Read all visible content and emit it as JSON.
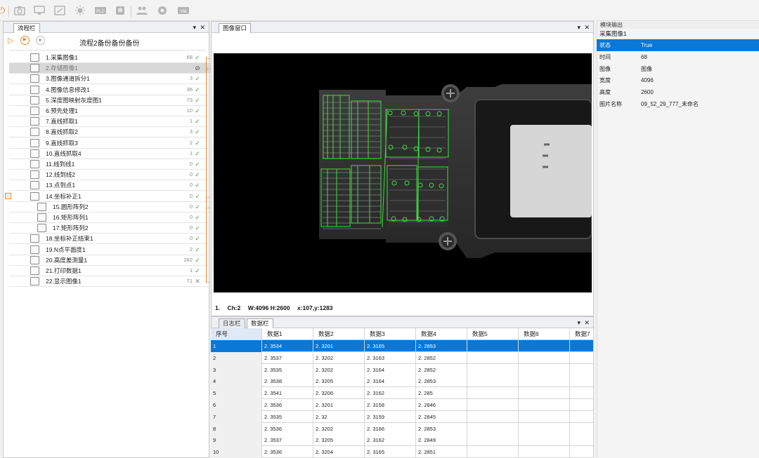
{
  "toolbar": {
    "icons": [
      "power-icon",
      "camera-icon",
      "screen-icon",
      "crop-icon",
      "light-icon",
      "plc-icon",
      "hand-icon",
      "users-icon",
      "settings-icon",
      "vm-icon"
    ],
    "plc_label": "PLC",
    "vm_label": "VM"
  },
  "flow_panel": {
    "tab_label": "流程栏",
    "title": "流程2备份备份备份",
    "items": [
      {
        "name": "1.采集图像1",
        "time": "68",
        "status": "ok"
      },
      {
        "name": "2.存储图像1",
        "time": "",
        "status": "disabled"
      },
      {
        "name": "3.图像通道拆分1",
        "time": "3",
        "status": "ok"
      },
      {
        "name": "4.图像信息修改1",
        "time": "36",
        "status": "ok"
      },
      {
        "name": "5.深度图映射灰度图1",
        "time": "73",
        "status": "ok"
      },
      {
        "name": "6.预先处理1",
        "time": "10",
        "status": "ok"
      },
      {
        "name": "7.直线抓取1",
        "time": "1",
        "status": "ok"
      },
      {
        "name": "8.直线抓取2",
        "time": "3",
        "status": "ok"
      },
      {
        "name": "9.直线抓取3",
        "time": "2",
        "status": "ok"
      },
      {
        "name": "10.直线抓取4",
        "time": "1",
        "status": "ok"
      },
      {
        "name": "11.线到线1",
        "time": "0",
        "status": "ok"
      },
      {
        "name": "12.线到线2",
        "time": "0",
        "status": "ok"
      },
      {
        "name": "13.点到点1",
        "time": "0",
        "status": "ok"
      },
      {
        "name": "14.坐标补正1",
        "time": "0",
        "status": "ok"
      },
      {
        "name": "15.圆形阵列2",
        "time": "0",
        "status": "ok"
      },
      {
        "name": "16.矩形阵列1",
        "time": "0",
        "status": "ok"
      },
      {
        "name": "17.矩形阵列2",
        "time": "0",
        "status": "ok"
      },
      {
        "name": "18.坐标补正结束1",
        "time": "0",
        "status": "ok"
      },
      {
        "name": "19.N点平面度1",
        "time": "2",
        "status": "ok"
      },
      {
        "name": "20.高度差测量1",
        "time": "282",
        "status": "ok"
      },
      {
        "name": "21.打印数据1",
        "time": "1",
        "status": "ok"
      },
      {
        "name": "22.显示图像1",
        "time": "71",
        "status": "err"
      }
    ]
  },
  "image_panel": {
    "tab_label": "图像窗口",
    "status": {
      "index": "1.",
      "channel": "Ch:2",
      "size": "W:4096 H:2600",
      "coords": "x:107,y:1283"
    }
  },
  "data_panel": {
    "tabs": [
      "日志栏",
      "数据栏"
    ],
    "columns": [
      "序号",
      "数据1",
      "数据2",
      "数据3",
      "数据4",
      "数据5",
      "数据6",
      "数据7"
    ],
    "rows": [
      [
        "1",
        "2. 3534",
        "2. 3201",
        "2. 3165",
        "2. 2853",
        "",
        "",
        ""
      ],
      [
        "2",
        "2. 3537",
        "2. 3202",
        "2. 3163",
        "2. 2852",
        "",
        "",
        ""
      ],
      [
        "3",
        "2. 3535",
        "2. 3202",
        "2. 3164",
        "2. 2852",
        "",
        "",
        ""
      ],
      [
        "4",
        "2. 3538",
        "2. 3205",
        "2. 3164",
        "2. 2853",
        "",
        "",
        ""
      ],
      [
        "5",
        "2. 3541",
        "2. 3206",
        "2. 3162",
        "2. 285",
        "",
        "",
        ""
      ],
      [
        "6",
        "2. 3536",
        "2. 3201",
        "2. 3158",
        "2. 2846",
        "",
        "",
        ""
      ],
      [
        "7",
        "2. 3535",
        "2. 32",
        "2. 3159",
        "2. 2845",
        "",
        "",
        ""
      ],
      [
        "8",
        "2. 3536",
        "2. 3202",
        "2. 3166",
        "2. 2853",
        "",
        "",
        ""
      ],
      [
        "9",
        "2. 3537",
        "2. 3205",
        "2. 3162",
        "2. 2849",
        "",
        "",
        ""
      ],
      [
        "10",
        "2. 3536",
        "2. 3204",
        "2. 3165",
        "2. 2851",
        "",
        "",
        ""
      ]
    ]
  },
  "output_panel": {
    "title": "模块输出",
    "module": "采集图像1",
    "rows": [
      {
        "key": "状态",
        "value": "True"
      },
      {
        "key": "时间",
        "value": "68"
      },
      {
        "key": "图像",
        "value": "图像"
      },
      {
        "key": "宽度",
        "value": "4096"
      },
      {
        "key": "高度",
        "value": "2600"
      },
      {
        "key": "图片名称",
        "value": "09_52_29_777_未命名"
      }
    ]
  },
  "colors": {
    "accent": "#0a78d7",
    "ok": "#3aa43a",
    "arrow": "#e8862a",
    "detect": "#3ce03c"
  }
}
